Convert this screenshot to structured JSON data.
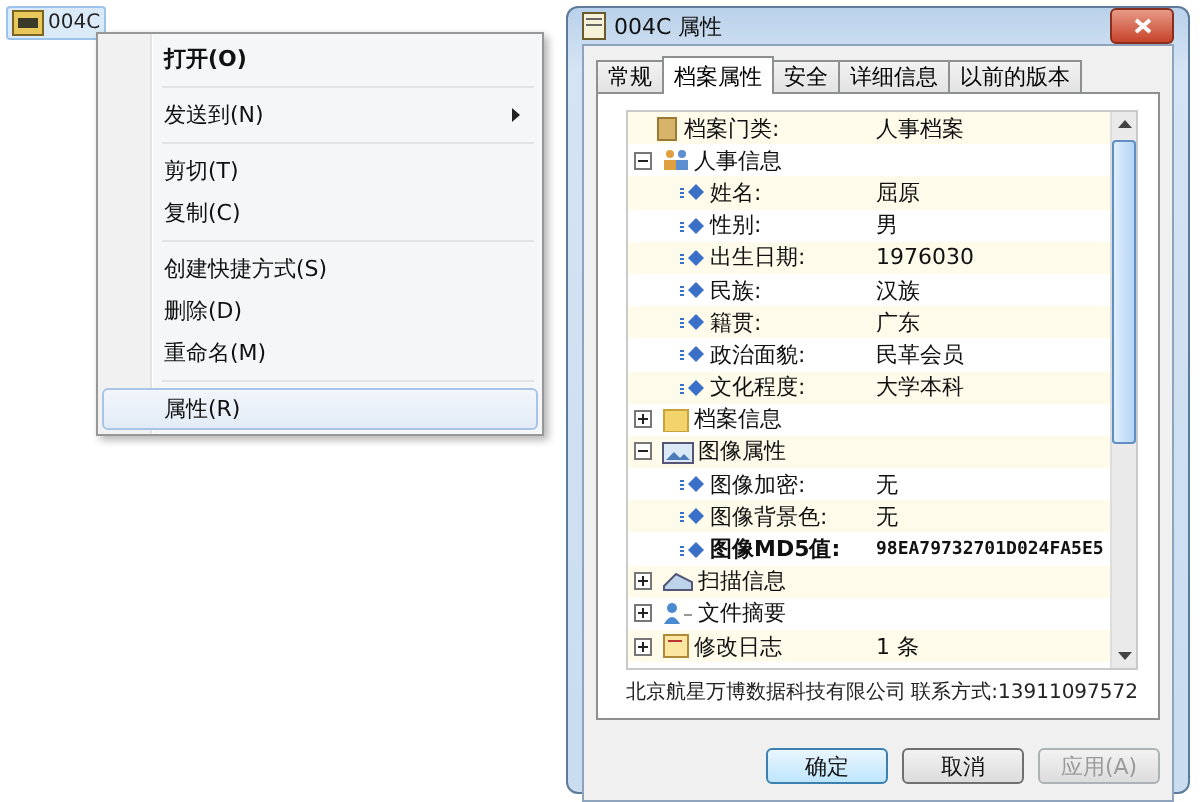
{
  "desktop_file": {
    "name": "004C",
    "selected": true
  },
  "context_menu": {
    "groups": [
      [
        {
          "label": "打开(O)",
          "default": true,
          "submenu": false,
          "highlighted": false
        }
      ],
      [
        {
          "label": "发送到(N)",
          "default": false,
          "submenu": true,
          "highlighted": false
        }
      ],
      [
        {
          "label": "剪切(T)",
          "default": false,
          "submenu": false,
          "highlighted": false
        },
        {
          "label": "复制(C)",
          "default": false,
          "submenu": false,
          "highlighted": false
        }
      ],
      [
        {
          "label": "创建快捷方式(S)",
          "default": false,
          "submenu": false,
          "highlighted": false
        },
        {
          "label": "删除(D)",
          "default": false,
          "submenu": false,
          "highlighted": false
        },
        {
          "label": "重命名(M)",
          "default": false,
          "submenu": false,
          "highlighted": false
        }
      ],
      [
        {
          "label": "属性(R)",
          "default": false,
          "submenu": false,
          "highlighted": true
        }
      ]
    ]
  },
  "window": {
    "title": "004C 属性"
  },
  "tabs": [
    {
      "label": "常规",
      "selected": false
    },
    {
      "label": "档案属性",
      "selected": true
    },
    {
      "label": "安全",
      "selected": false
    },
    {
      "label": "详细信息",
      "selected": false
    },
    {
      "label": "以前的版本",
      "selected": false
    }
  ],
  "tree": [
    {
      "kind": "category",
      "label": "档案门类:",
      "value": "人事档案"
    },
    {
      "kind": "group",
      "label": "人事信息",
      "expanded": true,
      "children": [
        {
          "label": "姓名:",
          "value": "屈原",
          "bold": false
        },
        {
          "label": "性别:",
          "value": "男",
          "bold": false
        },
        {
          "label": "出生日期:",
          "value": "1976030",
          "bold": false
        },
        {
          "label": "民族:",
          "value": "汉族",
          "bold": false
        },
        {
          "label": "籍贯:",
          "value": "广东",
          "bold": false
        },
        {
          "label": "政治面貌:",
          "value": "民革会员",
          "bold": false
        },
        {
          "label": "文化程度:",
          "value": "大学本科",
          "bold": false
        }
      ]
    },
    {
      "kind": "group",
      "label": "档案信息",
      "expanded": false
    },
    {
      "kind": "group",
      "label": "图像属性",
      "expanded": true,
      "children": [
        {
          "label": "图像加密:",
          "value": "无",
          "bold": false
        },
        {
          "label": "图像背景色:",
          "value": "无",
          "bold": false
        },
        {
          "label": "图像MD5值:",
          "value": "98EA79732701D024FA5E5",
          "bold": true
        }
      ]
    },
    {
      "kind": "group",
      "label": "扫描信息",
      "expanded": false
    },
    {
      "kind": "group",
      "label": "文件摘要",
      "expanded": false
    },
    {
      "kind": "group",
      "label": "修改日志",
      "expanded": false,
      "value": "1 条"
    }
  ],
  "footer": {
    "company": "北京航星万博数据科技有限公司",
    "contact": "联系方式:13911097572"
  },
  "buttons": [
    {
      "label": "确定",
      "default": true,
      "disabled": false
    },
    {
      "label": "取消",
      "default": false,
      "disabled": false
    },
    {
      "label": "应用(A)",
      "default": false,
      "disabled": true
    }
  ]
}
